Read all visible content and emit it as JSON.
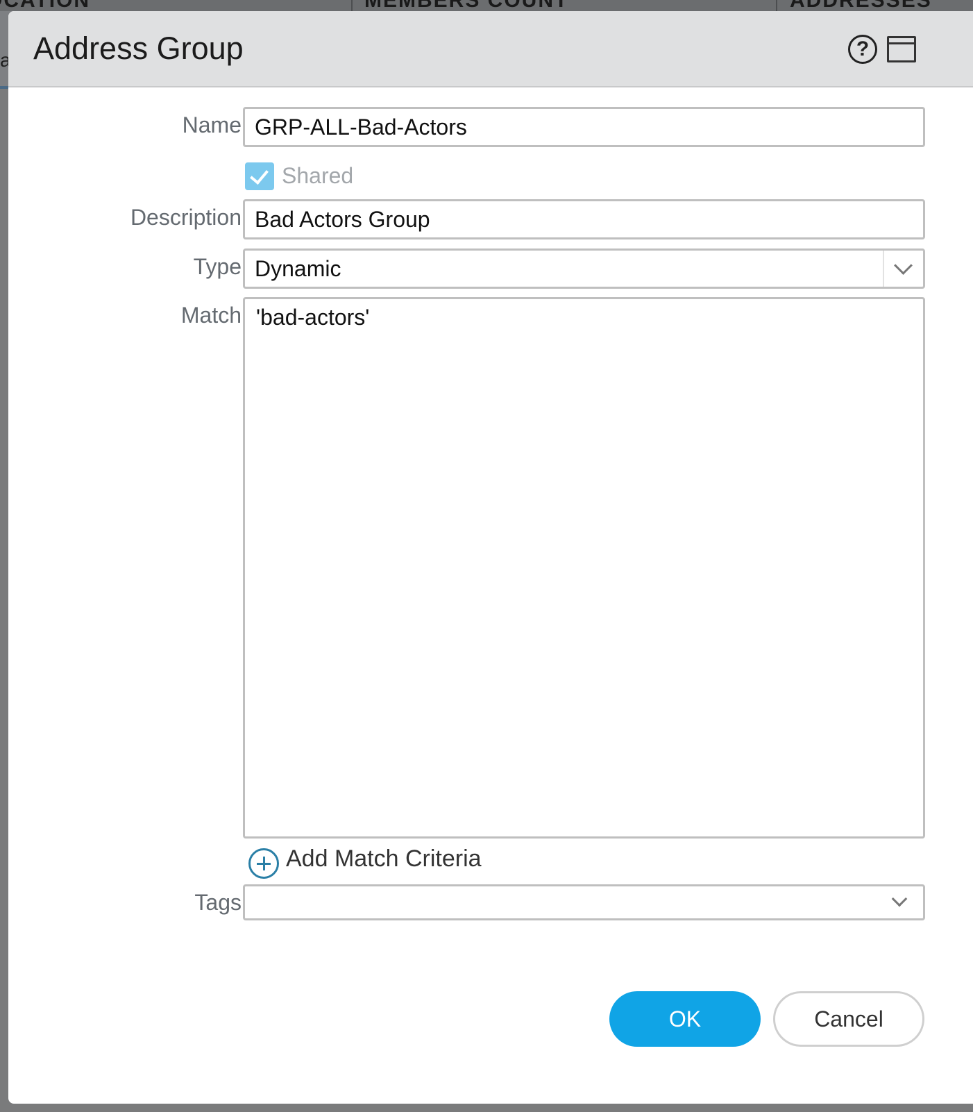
{
  "background": {
    "columns": [
      "OCATION",
      "MEMBERS COUNT",
      "ADDRESSES"
    ],
    "row_fragment": "a"
  },
  "dialog": {
    "title": "Address Group",
    "help_icon": "help-icon",
    "maximize_icon": "maximize-icon",
    "fields": {
      "name": {
        "label": "Name",
        "value": "GRP-ALL-Bad-Actors"
      },
      "shared": {
        "label": "Shared",
        "checked": true,
        "disabled": true
      },
      "description": {
        "label": "Description",
        "value": "Bad Actors Group"
      },
      "type": {
        "label": "Type",
        "value": "Dynamic"
      },
      "match": {
        "label": "Match",
        "value": "'bad-actors'"
      },
      "tags": {
        "label": "Tags",
        "value": ""
      }
    },
    "add_match_label": "Add Match Criteria",
    "buttons": {
      "ok": "OK",
      "cancel": "Cancel"
    },
    "colors": {
      "primary": "#10a4e6",
      "checkbox": "#7cc9ee",
      "header_bg": "#dfe0e1"
    }
  }
}
